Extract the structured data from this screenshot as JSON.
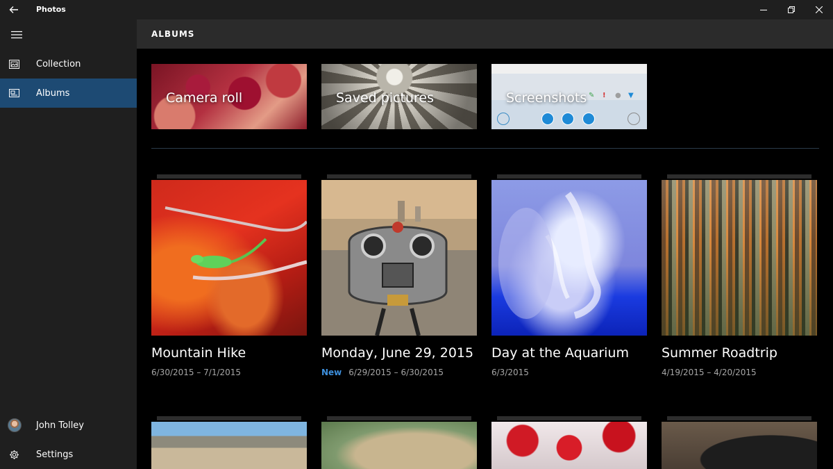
{
  "window": {
    "title": "Photos"
  },
  "sidebar": {
    "items": [
      {
        "label": "Collection",
        "icon": "collection-icon",
        "active": false
      },
      {
        "label": "Albums",
        "icon": "albums-icon",
        "active": true
      }
    ],
    "user": {
      "name": "John Tolley"
    },
    "settings": {
      "label": "Settings",
      "icon": "gear-icon"
    }
  },
  "header": {
    "title": "ALBUMS"
  },
  "featured": [
    {
      "label": "Camera roll"
    },
    {
      "label": "Saved pictures"
    },
    {
      "label": "Screenshots"
    }
  ],
  "albums": [
    {
      "title": "Mountain Hike",
      "dates": "6/30/2015 – 7/1/2015",
      "badge": ""
    },
    {
      "title": "Monday, June 29, 2015",
      "dates": "6/29/2015 – 6/30/2015",
      "badge": "New"
    },
    {
      "title": "Day at the Aquarium",
      "dates": "6/3/2015",
      "badge": ""
    },
    {
      "title": "Summer Roadtrip",
      "dates": "4/19/2015 – 4/20/2015",
      "badge": ""
    }
  ],
  "colors": {
    "accent": "#1d4a73",
    "badge": "#3d8fdc",
    "sidebar_bg": "#1f1f1f",
    "header_bg": "#2b2b2b"
  }
}
